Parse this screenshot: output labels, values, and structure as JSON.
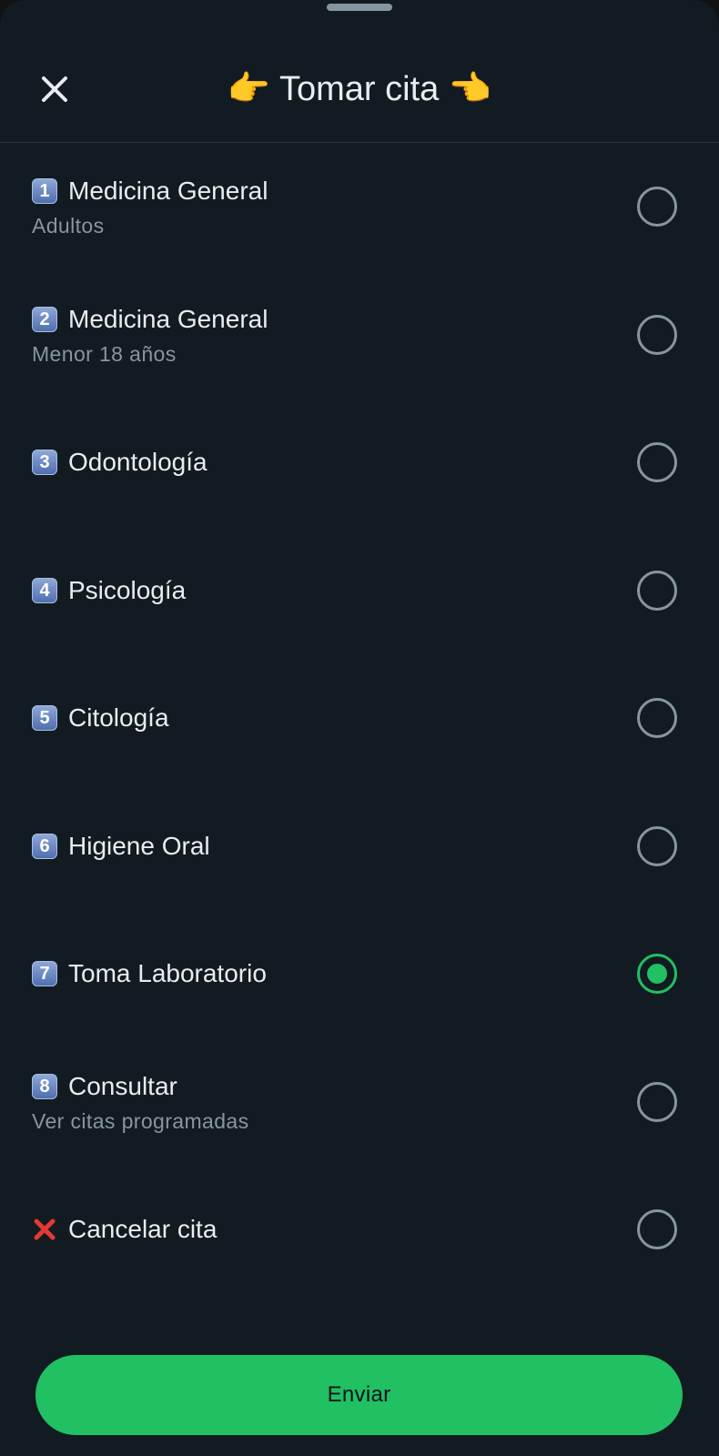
{
  "header": {
    "title": "👉 Tomar cita 👈"
  },
  "options": [
    {
      "key": "1",
      "label": "Medicina General",
      "sub": "Adultos",
      "checked": false
    },
    {
      "key": "2",
      "label": "Medicina General",
      "sub": "Menor 18 años",
      "checked": false
    },
    {
      "key": "3",
      "label": "Odontología",
      "sub": "",
      "checked": false
    },
    {
      "key": "4",
      "label": "Psicología",
      "sub": "",
      "checked": false
    },
    {
      "key": "5",
      "label": "Citología",
      "sub": "",
      "checked": false
    },
    {
      "key": "6",
      "label": "Higiene Oral",
      "sub": "",
      "checked": false
    },
    {
      "key": "7",
      "label": "Toma Laboratorio",
      "sub": "",
      "checked": true
    },
    {
      "key": "8",
      "label": "Consultar",
      "sub": "Ver citas programadas",
      "checked": false
    },
    {
      "key": "",
      "icon": "cross-mark-icon",
      "label": "Cancelar cita",
      "sub": "",
      "checked": false
    }
  ],
  "footer": {
    "send_label": "Enviar"
  },
  "colors": {
    "background": "#111b21",
    "accent": "#21c063",
    "text_primary": "#e9edef",
    "text_secondary": "#8696a0"
  }
}
